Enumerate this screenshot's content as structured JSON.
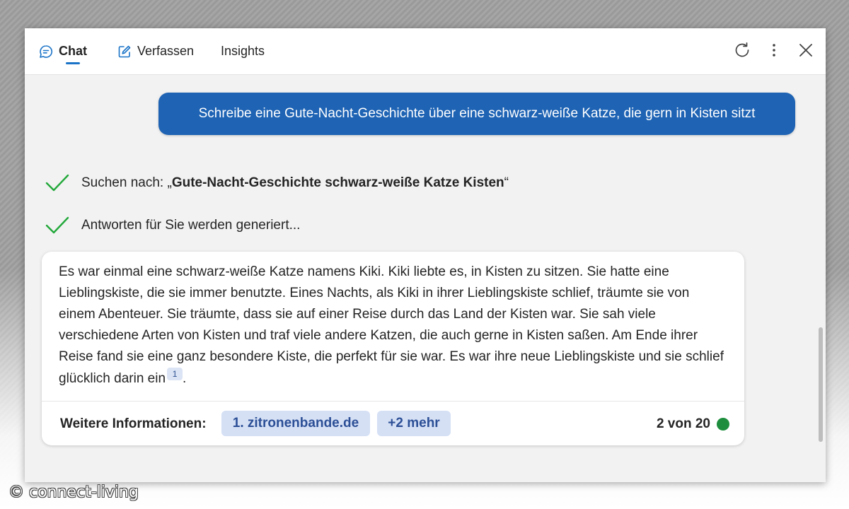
{
  "tabs": [
    {
      "label": "Chat",
      "icon": "chat-bubble-icon",
      "active": true
    },
    {
      "label": "Verfassen",
      "icon": "compose-icon",
      "active": false
    },
    {
      "label": "Insights",
      "active": false
    }
  ],
  "toolbar": {
    "refresh_icon": "refresh-icon",
    "more_icon": "more-vertical-icon",
    "close_icon": "close-icon"
  },
  "user_message": "Schreibe eine Gute-Nacht-Geschichte über eine schwarz-weiße Katze, die gern in Kisten sitzt",
  "status": {
    "search_prefix": "Suchen nach: „",
    "search_query": "Gute-Nacht-Geschichte schwarz-weiße Katze Kisten",
    "search_suffix": "“",
    "generating": "Antworten für Sie werden generiert..."
  },
  "answer": {
    "text": "Es war einmal eine schwarz-weiße Katze namens Kiki. Kiki liebte es, in Kisten zu sitzen. Sie hatte eine Lieblingskiste, die sie immer benutzte. Eines Nachts, als Kiki in ihrer Lieblingskiste schlief, träumte sie von einem Abenteuer. Sie träumte, dass sie auf einer Reise durch das Land der Kisten war. Sie sah viele verschiedene Arten von Kisten und traf viele andere Katzen, die auch gerne in Kisten saßen. Am Ende ihrer Reise fand sie eine ganz besondere Kiste, die perfekt für sie war. Es war ihre neue Lieblingskiste und sie schlief glücklich darin ein",
    "citation": "1",
    "end": "."
  },
  "footer": {
    "more_info_label": "Weitere Informationen:",
    "source_chip": "1. zitronenbande.de",
    "more_chip": "+2 mehr",
    "counter": "2 von 20",
    "dot_color": "#1e8e3e"
  },
  "colors": {
    "accent": "#1a73c7",
    "bubble": "#1e63b4",
    "check": "#22a83a"
  },
  "watermark": "© connect-living"
}
